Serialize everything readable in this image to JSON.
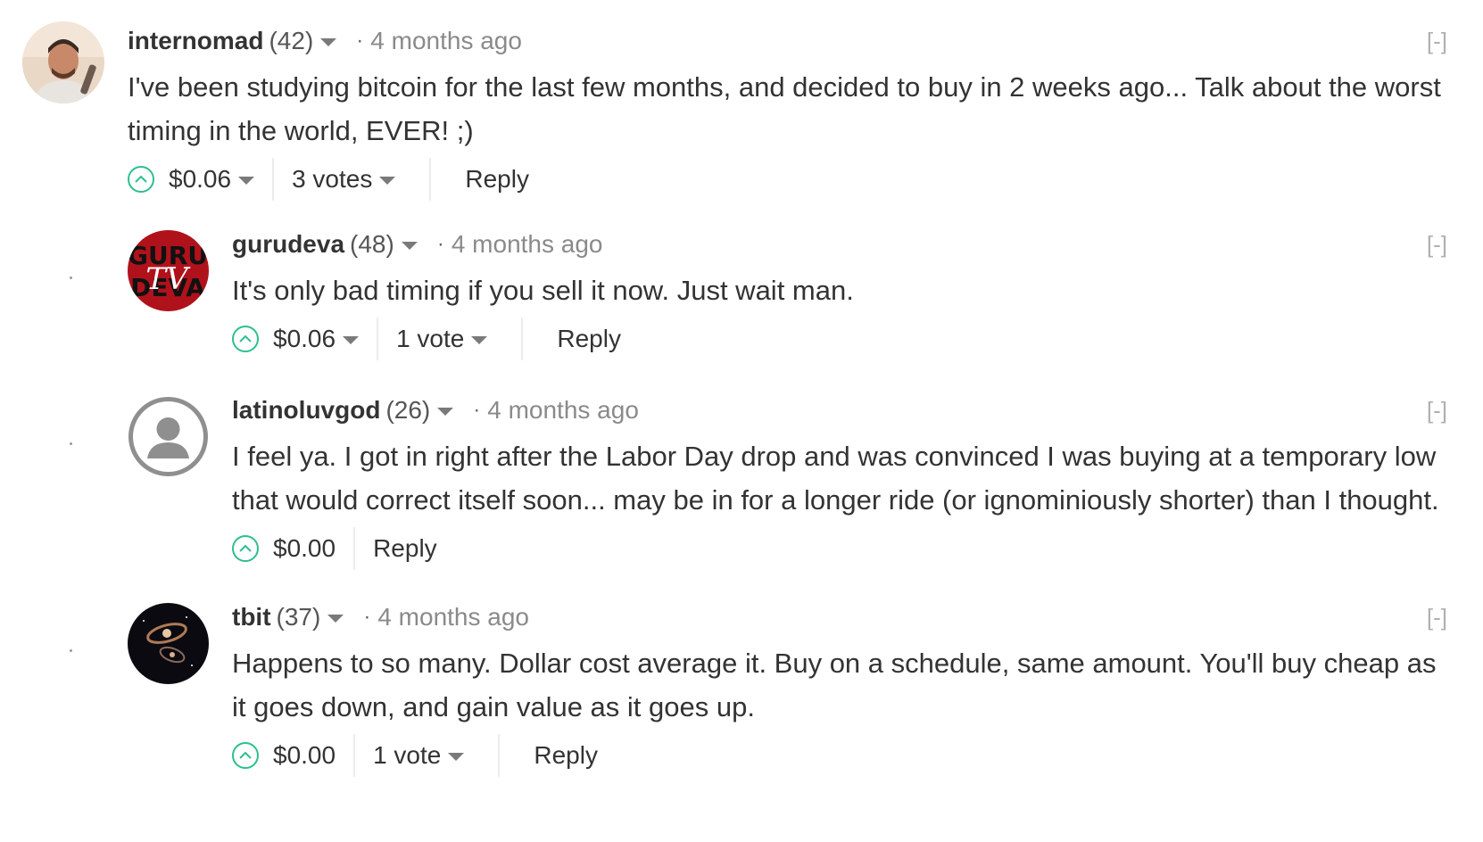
{
  "comments": [
    {
      "author": "internomad",
      "reputation": "(42)",
      "timestamp": "4 months ago",
      "collapse": "[-]",
      "text": "I've been studying bitcoin for the last few months, and decided to buy in 2 weeks ago... Talk about the worst timing in the world, EVER! ;)",
      "payout": "$0.06",
      "votes": "3 votes",
      "reply": "Reply",
      "avatar_icon": "profile-photo-icon"
    },
    {
      "author": "gurudeva",
      "reputation": "(48)",
      "timestamp": "4 months ago",
      "collapse": "[-]",
      "text": "It's only bad timing if you sell it now. Just wait man.",
      "payout": "$0.06",
      "votes": "1 vote",
      "reply": "Reply",
      "avatar_icon": "guru-deva-tv-logo-icon",
      "avatar_text_top": "GURU",
      "avatar_text_mid": "DEVA",
      "avatar_text_tv": "TV"
    },
    {
      "author": "latinoluvgod",
      "reputation": "(26)",
      "timestamp": "4 months ago",
      "collapse": "[-]",
      "text": "I feel ya. I got in right after the Labor Day drop and was convinced I was buying at a temporary low that would correct itself soon... may be in for a longer ride (or ignominiously shorter) than I thought.",
      "payout": "$0.00",
      "reply": "Reply",
      "avatar_icon": "default-user-icon"
    },
    {
      "author": "tbit",
      "reputation": "(37)",
      "timestamp": "4 months ago",
      "collapse": "[-]",
      "text": "Happens to so many. Dollar cost average it. Buy on a schedule, same amount. You'll buy cheap as it goes down, and gain value as it goes up.",
      "payout": "$0.00",
      "votes": "1 vote",
      "reply": "Reply",
      "avatar_icon": "galaxy-icon"
    }
  ],
  "colors": {
    "upvote_accent": "#2dbf8e",
    "text": "#333333",
    "muted": "#8a8a8a"
  }
}
